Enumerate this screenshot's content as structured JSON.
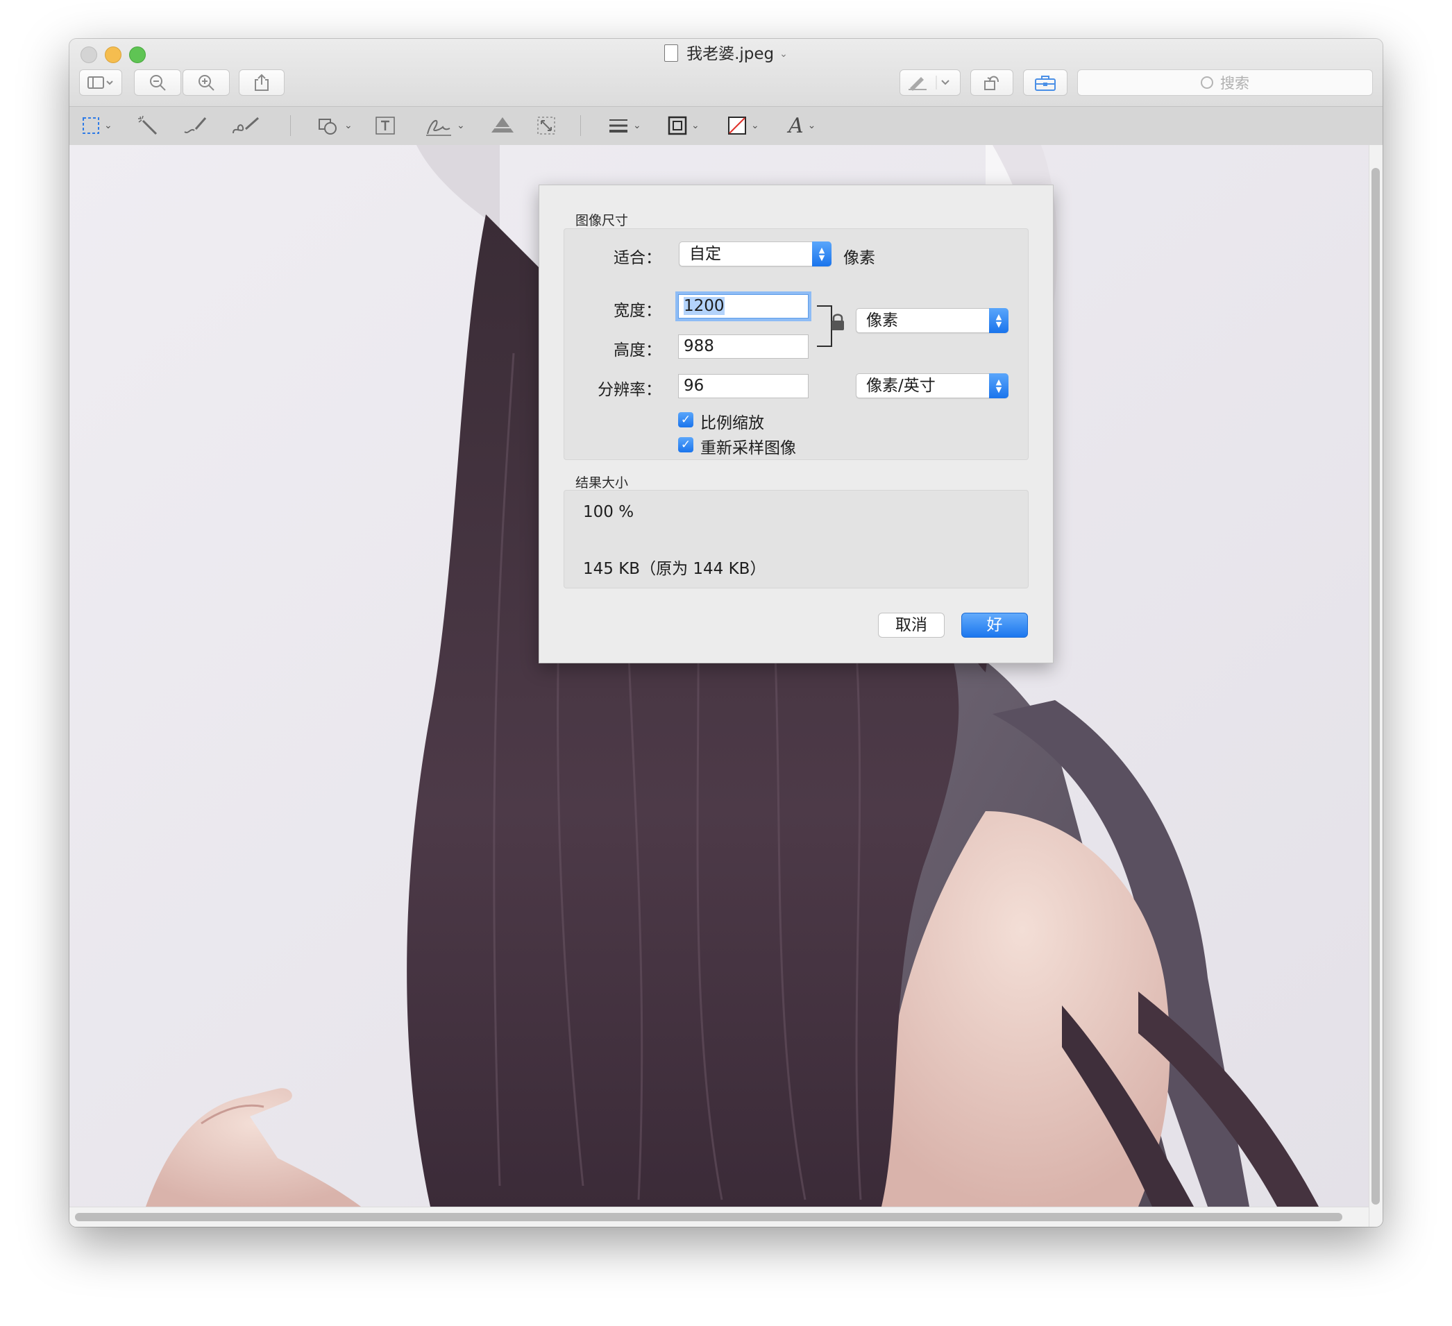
{
  "window": {
    "title": "我老婆.jpeg",
    "search_placeholder": "搜索"
  },
  "toolbar": {
    "items": [
      {
        "name": "sidebar-toggle",
        "icon": "sidebar-icon"
      },
      {
        "name": "zoom-out",
        "icon": "zoom-out-icon"
      },
      {
        "name": "zoom-in",
        "icon": "zoom-in-icon"
      },
      {
        "name": "share",
        "icon": "share-icon"
      },
      {
        "name": "markup",
        "icon": "pen-icon"
      },
      {
        "name": "rotate",
        "icon": "rotate-icon"
      },
      {
        "name": "toolbox",
        "icon": "toolbox-icon"
      }
    ]
  },
  "markup_toolbar": {
    "items": [
      "selection",
      "instant-alpha",
      "sketch",
      "draw",
      "shapes",
      "text",
      "sign",
      "adjust-color",
      "adjust-size",
      "line-style",
      "border-color",
      "fill-color",
      "text-style"
    ]
  },
  "dialog": {
    "section_image_size": "图像尺寸",
    "fit_label": "适合：",
    "fit_value": "自定",
    "fit_unit": "像素",
    "width_label": "宽度：",
    "width_value": "1200",
    "height_label": "高度：",
    "height_value": "988",
    "size_unit": "像素",
    "resolution_label": "分辨率：",
    "resolution_value": "96",
    "resolution_unit": "像素/英寸",
    "scale_proportionally": "比例缩放",
    "resample_image": "重新采样图像",
    "scale_checked": true,
    "resample_checked": true,
    "section_result_size": "结果大小",
    "result_percent": "100 %",
    "result_filesize": "145 KB（原为 144 KB）",
    "cancel_label": "取消",
    "ok_label": "好"
  },
  "colors": {
    "accent": "#1a74ec",
    "traffic_close": "#d4d4d4",
    "traffic_minimize": "#f5bd4f",
    "traffic_zoom": "#5fc454"
  }
}
